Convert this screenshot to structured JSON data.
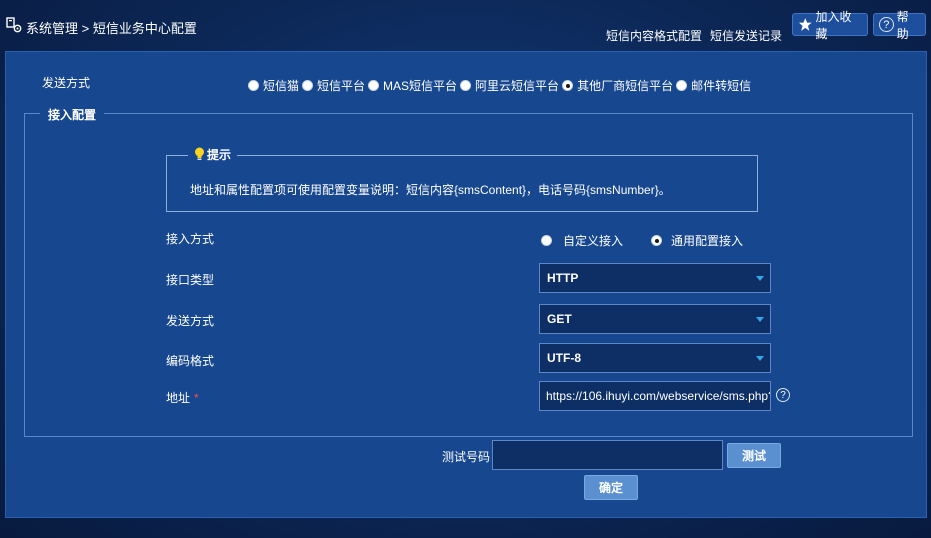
{
  "header": {
    "breadcrumb": "系统管理 > 短信业务中心配置",
    "links": [
      "短信内容格式配置",
      "短信发送记录"
    ],
    "favorite_label": "加入收藏",
    "help_label": "帮助"
  },
  "send_method": {
    "label": "发送方式",
    "options": [
      "短信猫",
      "短信平台",
      "MAS短信平台",
      "阿里云短信平台",
      "其他厂商短信平台",
      "邮件转短信"
    ],
    "selected": "其他厂商短信平台"
  },
  "access_config": {
    "legend": "接入配置",
    "tip": {
      "title": "提示",
      "text": "地址和属性配置项可使用配置变量说明：短信内容{smsContent}，电话号码{smsNumber}。"
    },
    "access_mode": {
      "label": "接入方式",
      "options": [
        "自定义接入",
        "通用配置接入"
      ],
      "selected": "通用配置接入"
    },
    "interface_type": {
      "label": "接口类型",
      "value": "HTTP"
    },
    "send_method": {
      "label": "发送方式",
      "value": "GET"
    },
    "encoding": {
      "label": "编码格式",
      "value": "UTF-8"
    },
    "address": {
      "label": "地址",
      "required_mark": "*",
      "value": "https://106.ihuyi.com/webservice/sms.php?"
    }
  },
  "test": {
    "label": "测试号码",
    "value": "",
    "button": "测试"
  },
  "confirm_button": "确定"
}
